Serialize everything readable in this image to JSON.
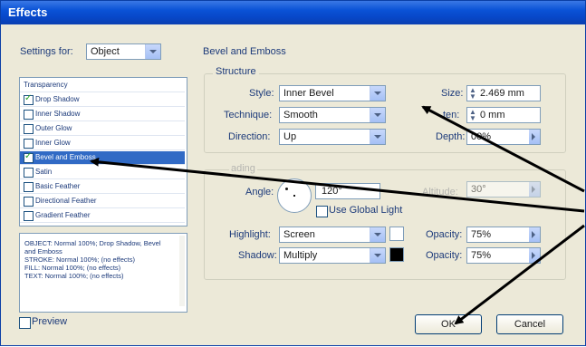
{
  "title": "Effects",
  "settings_for": {
    "label": "Settings for:",
    "value": "Object"
  },
  "effects_list": [
    {
      "label": "Transparency",
      "checkbox": false,
      "checked": false,
      "selected": false
    },
    {
      "label": "Drop Shadow",
      "checkbox": true,
      "checked": true,
      "selected": false
    },
    {
      "label": "Inner Shadow",
      "checkbox": true,
      "checked": false,
      "selected": false
    },
    {
      "label": "Outer Glow",
      "checkbox": true,
      "checked": false,
      "selected": false
    },
    {
      "label": "Inner Glow",
      "checkbox": true,
      "checked": false,
      "selected": false
    },
    {
      "label": "Bevel and Emboss",
      "checkbox": true,
      "checked": true,
      "selected": true
    },
    {
      "label": "Satin",
      "checkbox": true,
      "checked": false,
      "selected": false
    },
    {
      "label": "Basic Feather",
      "checkbox": true,
      "checked": false,
      "selected": false
    },
    {
      "label": "Directional Feather",
      "checkbox": true,
      "checked": false,
      "selected": false
    },
    {
      "label": "Gradient Feather",
      "checkbox": true,
      "checked": false,
      "selected": false
    }
  ],
  "summary": "OBJECT: Normal 100%; Drop Shadow, Bevel and Emboss\nSTROKE: Normal 100%; (no effects)\nFILL: Normal 100%; (no effects)\nTEXT: Normal 100%; (no effects)",
  "section_title": "Bevel and Emboss",
  "structure": {
    "title": "Structure",
    "style": {
      "label": "Style:",
      "value": "Inner Bevel"
    },
    "technique": {
      "label": "Technique:",
      "value": "Smooth"
    },
    "direction": {
      "label": "Direction:",
      "value": "Up"
    },
    "size": {
      "label": "Size:",
      "value": "2.469 mm"
    },
    "soften": {
      "label": "ten:",
      "value": "0 mm"
    },
    "depth": {
      "label": "Depth:",
      "value": "00%"
    }
  },
  "shading": {
    "title": "ading",
    "angle": {
      "label": "Angle:",
      "value": "120°"
    },
    "altitude": {
      "label": "Altitude:",
      "value": "30°"
    },
    "use_global_light": {
      "label": "Use Global Light",
      "checked": false
    },
    "highlight": {
      "label": "Highlight:",
      "value": "Screen",
      "color": "#ffffff",
      "opacity_label": "Opacity:",
      "opacity": "75%"
    },
    "shadow": {
      "label": "Shadow:",
      "value": "Multiply",
      "color": "#000000",
      "opacity_label": "Opacity:",
      "opacity": "75%"
    }
  },
  "preview": {
    "label": "Preview",
    "checked": false
  },
  "buttons": {
    "ok": "OK",
    "cancel": "Cancel"
  },
  "colors": {
    "title_bar": "#0a52d6",
    "selection": "#316ac5",
    "arrow": "#000000"
  }
}
